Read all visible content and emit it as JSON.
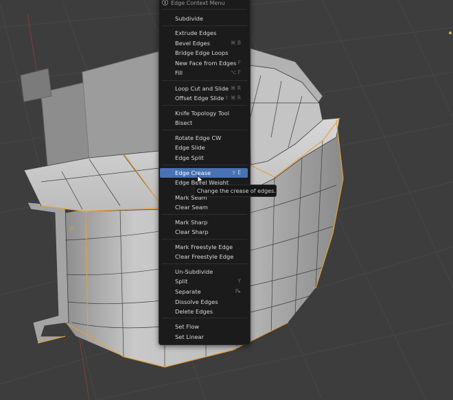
{
  "menu": {
    "title": "Edge Context Menu",
    "title_icon": "info-icon",
    "highlight_color": "#4772b3",
    "items": {
      "subdivide": "Subdivide",
      "extrude_edges": "Extrude Edges",
      "bevel_edges": "Bevel Edges",
      "bevel_edges_shortcut": "⌘ B",
      "bridge_edge_loops": "Bridge Edge Loops",
      "new_face_from_edges": "New Face from Edges",
      "new_face_from_edges_shortcut": "F",
      "fill": "Fill",
      "fill_shortcut": "⌥ F",
      "loop_cut_and_slide": "Loop Cut and Slide",
      "loop_cut_and_slide_shortcut": "⌘ R",
      "offset_edge_slide": "Offset Edge Slide",
      "offset_edge_slide_shortcut": "⇧ ⌘ R",
      "knife_topology_tool": "Knife Topology Tool",
      "bisect": "Bisect",
      "rotate_edge_cw": "Rotate Edge CW",
      "edge_slide": "Edge Slide",
      "edge_split": "Edge Split",
      "edge_crease": "Edge Crease",
      "edge_crease_shortcut": "⇧ E",
      "edge_bevel_weight": "Edge Bevel Weight",
      "mark_seam": "Mark Seam",
      "clear_seam": "Clear Seam",
      "mark_sharp": "Mark Sharp",
      "clear_sharp": "Clear Sharp",
      "mark_freestyle_edge": "Mark Freestyle Edge",
      "clear_freestyle_edge": "Clear Freestyle Edge",
      "un_subdivide": "Un-Subdivide",
      "split": "Split",
      "split_shortcut": "Y",
      "separate": "Separate",
      "separate_shortcut": "P▸",
      "dissolve_edges": "Dissolve Edges",
      "delete_edges": "Delete Edges",
      "set_flow": "Set Flow",
      "set_linear": "Set Linear"
    }
  },
  "tooltip": {
    "text": "Change the crease of edges."
  },
  "viewport": {
    "background": "#3d3d3d",
    "mesh_color": "#b9b9b9",
    "selected_edge_color": "#e8a13a"
  }
}
